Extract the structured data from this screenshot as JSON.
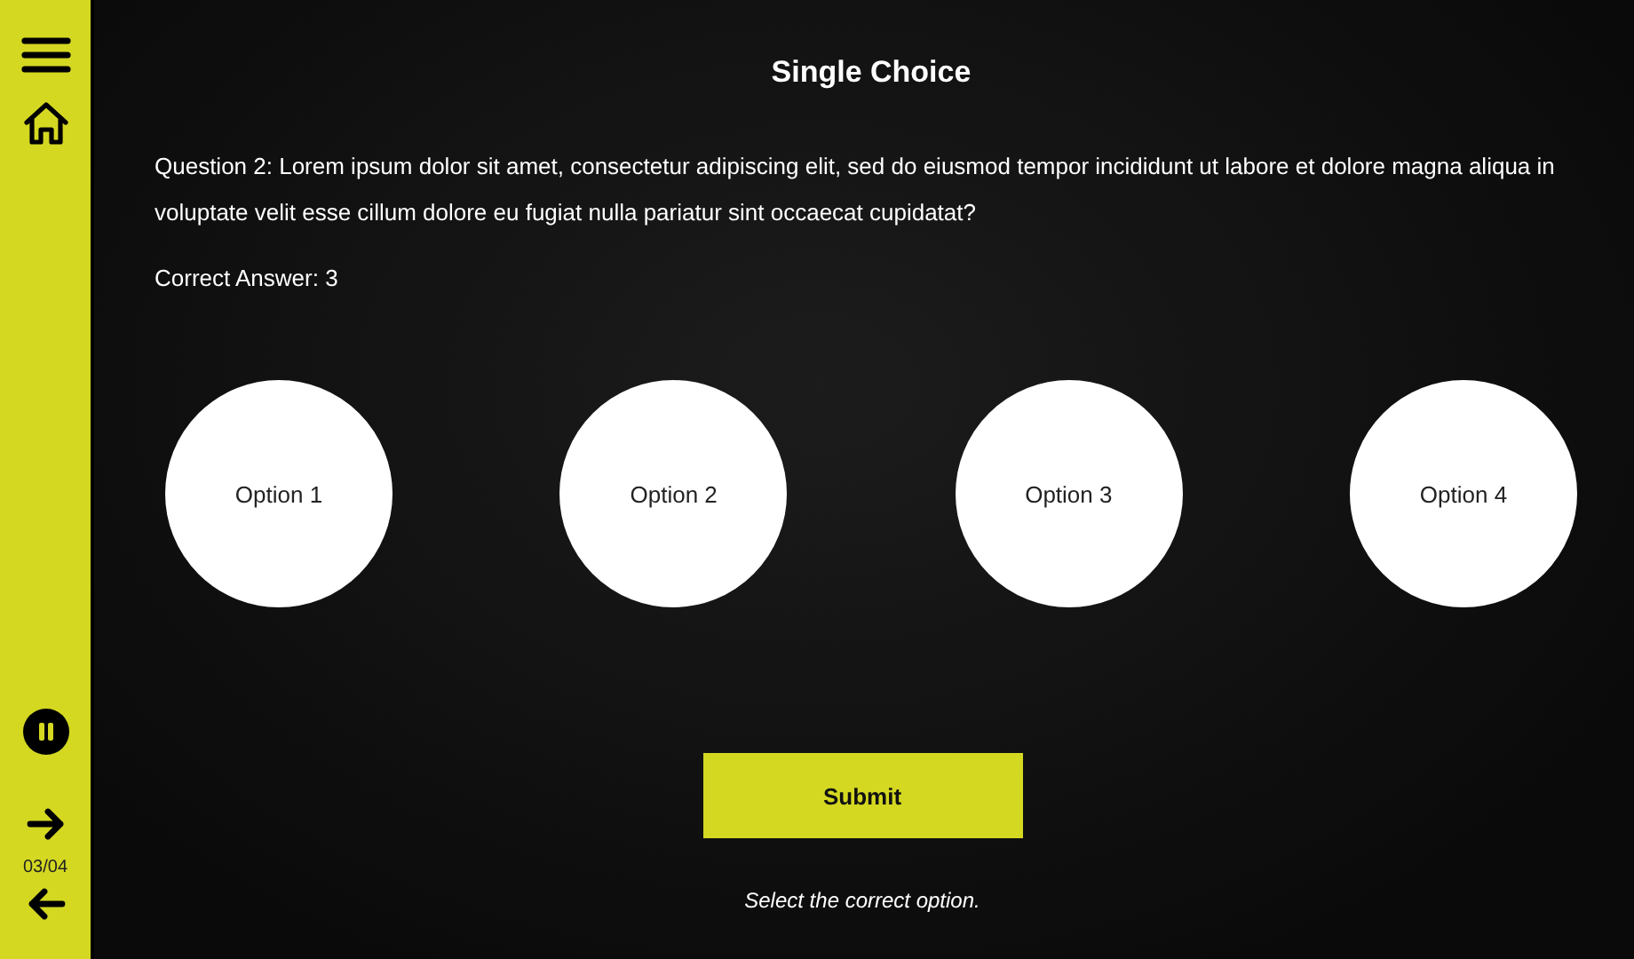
{
  "title": "Single Choice",
  "question": "Question 2: Lorem ipsum dolor sit amet, consectetur adipiscing elit, sed do eiusmod tempor incididunt ut labore et dolore magna aliqua in voluptate velit esse cillum dolore eu fugiat nulla pariatur sint occaecat cupidatat?",
  "correct_answer": "Correct Answer: 3",
  "options": [
    {
      "label": "Option 1",
      "selected": false
    },
    {
      "label": "Option 2",
      "selected": false
    },
    {
      "label": "Option 3",
      "selected": false
    },
    {
      "label": "Option 4",
      "selected": false
    }
  ],
  "submit": "Submit",
  "hint": "Select the correct option.",
  "sidebar": {
    "page_counter": "03/04"
  }
}
